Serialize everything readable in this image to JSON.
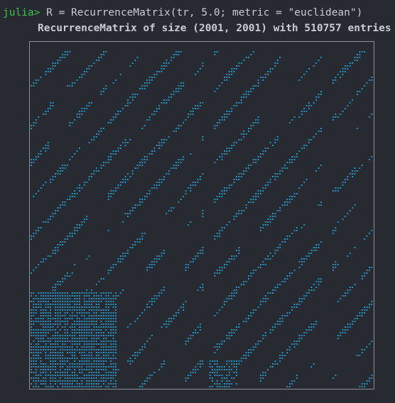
{
  "repl": {
    "prompt": "julia>",
    "command": " R = RecurrenceMatrix(tr, 5.0; metric = \"euclidean\")",
    "output": "RecurrenceMatrix of size (2001, 2001) with 510757 entries"
  },
  "plot": {
    "dot_color": "#1d9fd2",
    "frame_color": "#8c9096",
    "prompt_color": "#3cc24a",
    "background": "#272b31"
  }
}
